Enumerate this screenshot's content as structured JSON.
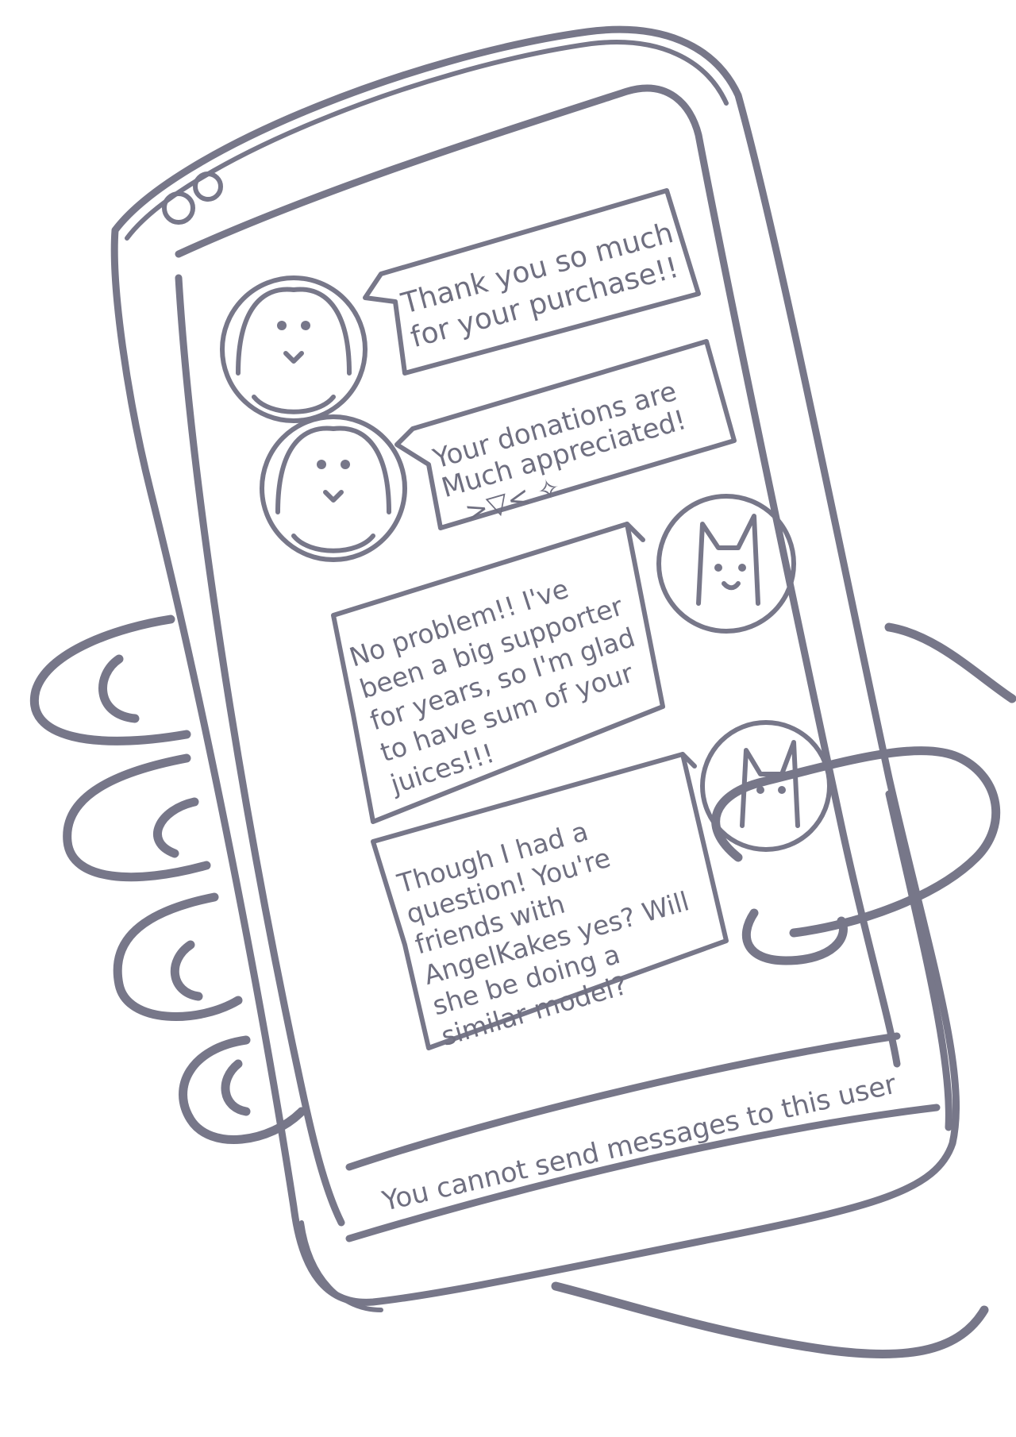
{
  "messages": [
    {
      "sender": "other",
      "lines": [
        "Thank you so much",
        "for your purchase!!"
      ]
    },
    {
      "sender": "other",
      "lines": [
        "Your donations are",
        "Much appreciated!",
        ">▽< ✧"
      ]
    },
    {
      "sender": "self",
      "lines": [
        "No problem!! I've",
        "been a big supporter",
        "for years, so I'm glad",
        "to have sum of your",
        "juices!!!"
      ]
    },
    {
      "sender": "self",
      "lines": [
        "Though I had a",
        "question! You're",
        "friends with",
        "AngelKakes yes? Will",
        "she be doing a",
        "similar model?"
      ]
    }
  ],
  "footer": {
    "notice": "You cannot send messages to this user"
  },
  "colors": {
    "ink": "#777789",
    "background": "#ffffff"
  }
}
